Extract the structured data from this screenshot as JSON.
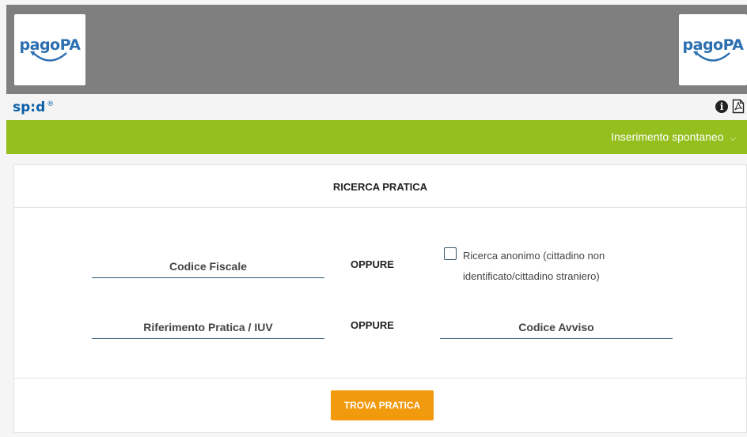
{
  "header": {
    "logo_left_text": "pagoPA",
    "logo_right_text": "pagoPA",
    "spid_text": "sp:d",
    "spid_reg": "®",
    "info_icon": "info-icon",
    "pdf_icon": "pdf-icon"
  },
  "nav": {
    "menu_label": "Inserimento spontaneo",
    "chevron": "⌄"
  },
  "panel": {
    "title": "RICERCA PRATICA",
    "codice_fiscale_placeholder": "Codice Fiscale",
    "oppure_1": "OPPURE",
    "anonimo_label": "Ricerca anonimo (cittadino non identificato/cittadino straniero)",
    "riferimento_placeholder": "Riferimento Pratica / IUV",
    "oppure_2": "OPPURE",
    "codice_avviso_placeholder": "Codice Avviso",
    "submit_label": "TROVA PRATICA"
  },
  "colors": {
    "header_gray": "#7f7f7f",
    "green_bar": "#94bf1f",
    "button_orange": "#f29a0e",
    "pagopa_blue": "#2c6fb1",
    "spid_blue": "#0b5fa8"
  }
}
